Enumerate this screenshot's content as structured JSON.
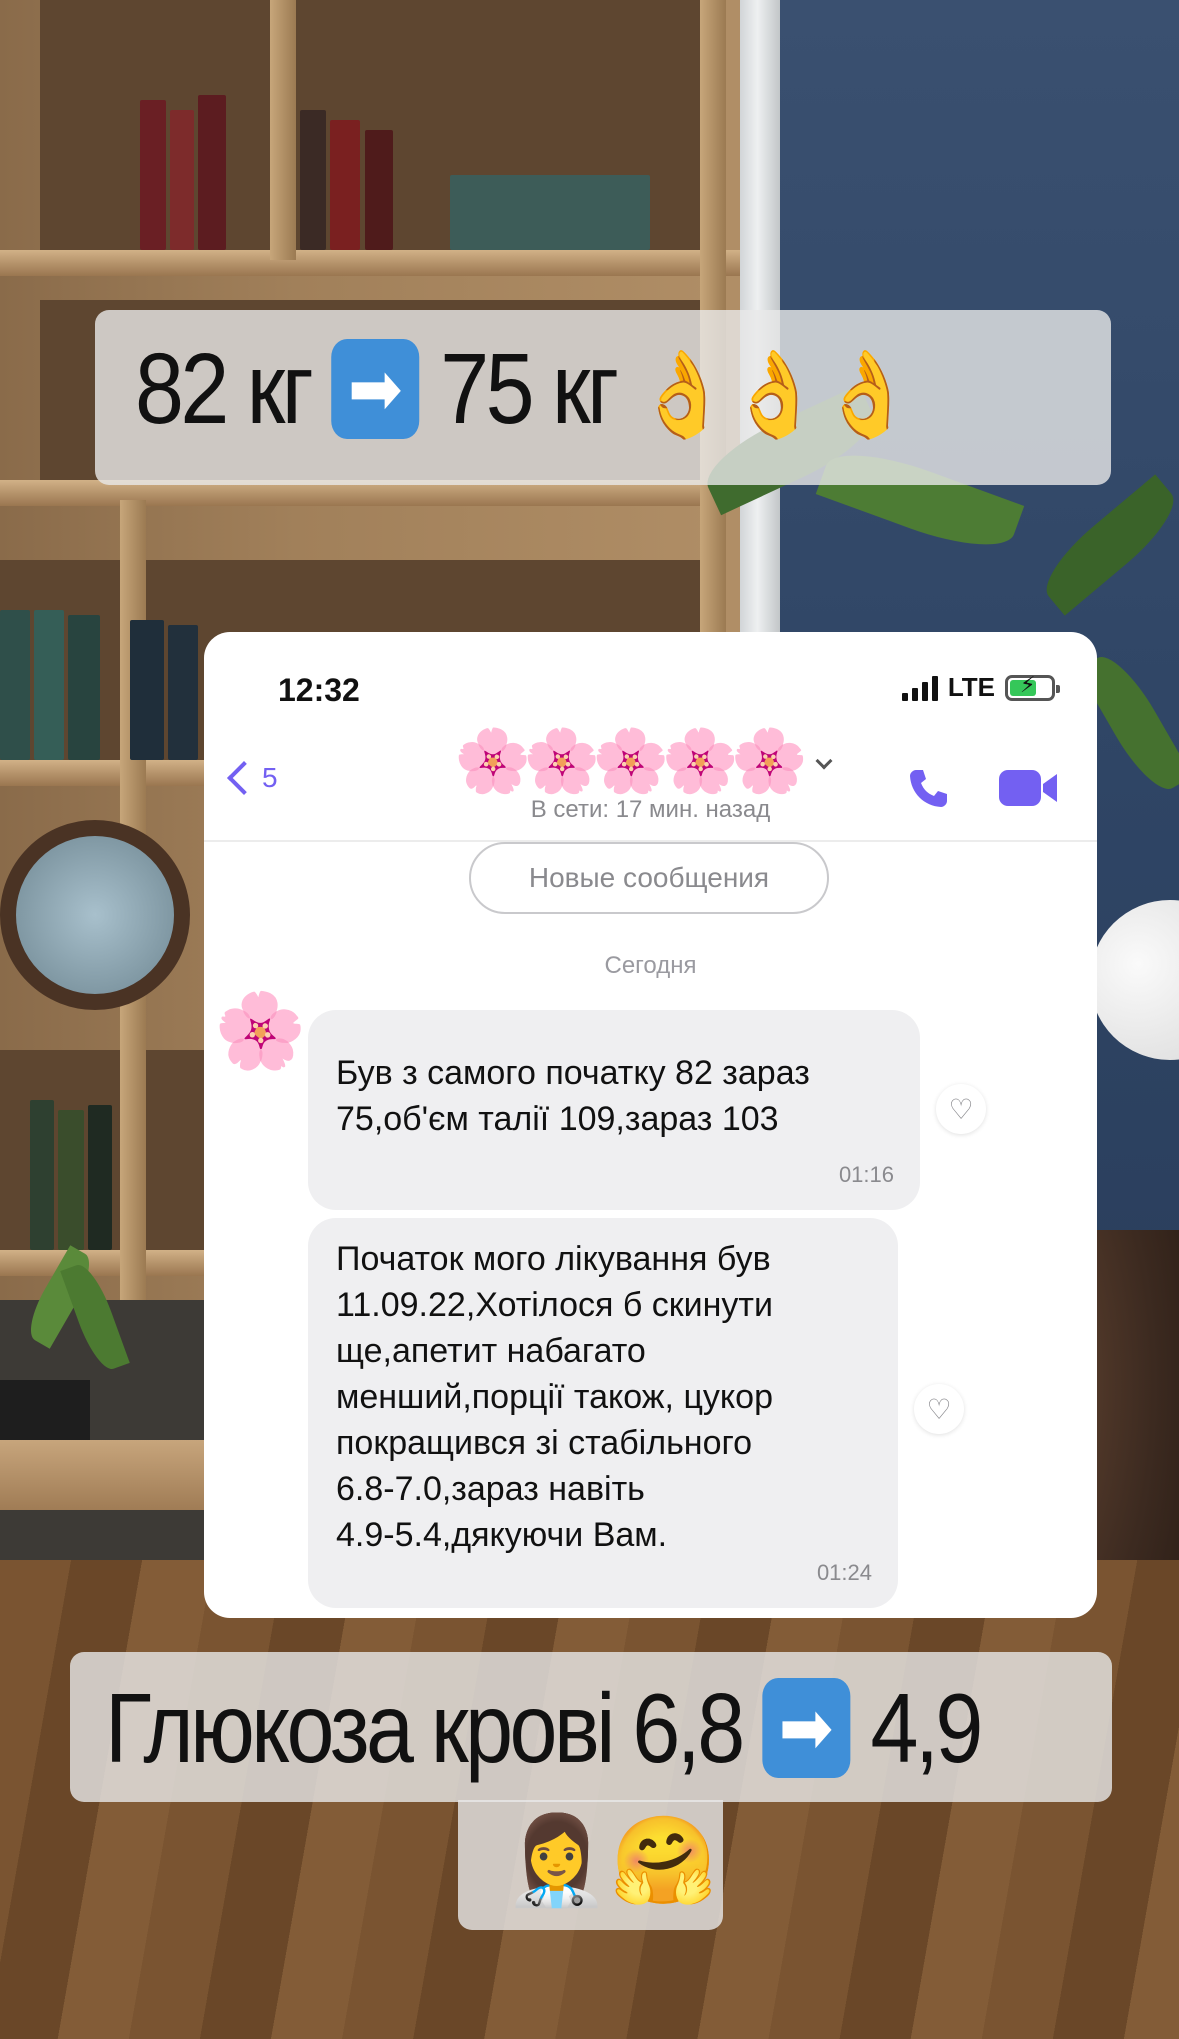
{
  "captions": {
    "top": {
      "before": "82 кг",
      "arrow": "➡",
      "after": "75 кг",
      "emoji": "👌👌👌"
    },
    "bottom": {
      "label": "Глюкоза крові 6,8",
      "arrow": "➡",
      "after": "4,9"
    },
    "emoji_line": "👩‍⚕️🤗"
  },
  "phone": {
    "status": {
      "time": "12:32",
      "network": "LTE"
    },
    "header": {
      "back_count": "5",
      "contact_name": "🌸🌸🌸🌸🌸",
      "contact_status": "В сети: 17 мин. назад"
    },
    "new_messages_label": "Новые сообщения",
    "day_separator": "Сегодня",
    "avatar": "🌸",
    "messages": [
      {
        "text": "Був з самого початку 82 зараз\n75,об'єм талії 109,зараз 103",
        "time": "01:16"
      },
      {
        "text": "Початок мого лікування  був\n11.09.22,Хотілося б скинути\nще,апетит набагато\nменший,порції також, цукор\nпокращився зі стабільного\n6.8-7.0,зараз  навіть\n4.9-5.4,дякуючи Вам.",
        "time": "01:24"
      }
    ],
    "colors": {
      "accent": "#7360f2",
      "bubble": "#efeff1",
      "battery": "#35c759"
    },
    "icons": [
      "back-chevron-icon",
      "call-icon",
      "video-call-icon",
      "heart-icon",
      "signal-icon",
      "battery-icon"
    ]
  }
}
